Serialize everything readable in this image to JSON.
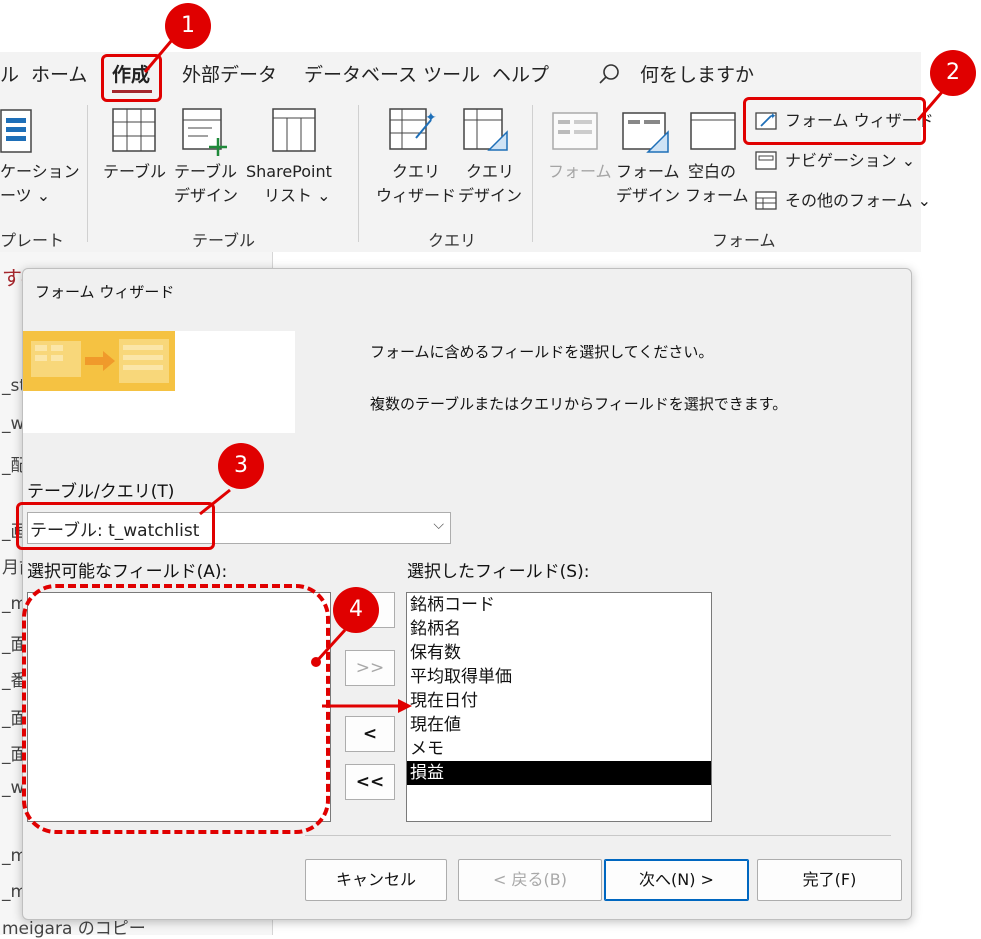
{
  "ribbon": {
    "tabs": [
      "ル",
      "ホーム",
      "作成",
      "外部データ",
      "データベース ツール",
      "ヘルプ"
    ],
    "active_tab_index": 2,
    "search_placeholder": "何をしますか",
    "groups": {
      "templates": {
        "label": "プレート",
        "item_line1": "ケーション",
        "item_line2": "ーツ ⌄"
      },
      "tables": {
        "label": "テーブル",
        "table": "テーブル",
        "table_design_1": "テーブル",
        "table_design_2": "デザイン",
        "sharepoint_1": "SharePoint",
        "sharepoint_2": "リスト ⌄"
      },
      "queries": {
        "label": "クエリ",
        "wizard_1": "クエリ",
        "wizard_2": "ウィザード",
        "design_1": "クエリ",
        "design_2": "デザイン"
      },
      "forms": {
        "label": "フォーム",
        "form": "フォーム",
        "form_design_1": "フォーム",
        "form_design_2": "デザイン",
        "blank_1": "空白の",
        "blank_2": "フォーム",
        "wizard": "フォーム ウィザード",
        "navigation": "ナビゲーション ⌄",
        "more": "その他のフォーム ⌄"
      }
    }
  },
  "nav_pane": {
    "items": [
      "すべての A",
      "_st",
      "_w",
      "_配",
      "_画",
      "月前",
      "_m",
      "_面",
      "_番",
      "_面",
      "_面",
      "_w",
      "_m",
      "_m",
      "meigara のコピー"
    ]
  },
  "dialog": {
    "title": "フォーム ウィザード",
    "instruction_1": "フォームに含めるフィールドを選択してください。",
    "instruction_2": "複数のテーブルまたはクエリからフィールドを選択できます。",
    "table_query_label": "テーブル/クエリ(T)",
    "table_query_value": "テーブル: t_watchlist",
    "available_label": "選択可能なフィールド(A):",
    "selected_label": "選択したフィールド(S):",
    "available_fields": [],
    "selected_fields": [
      "銘柄コード",
      "銘柄名",
      "保有数",
      "平均取得単価",
      "現在日付",
      "現在値",
      "メモ",
      "損益"
    ],
    "selected_index": 7,
    "move_buttons": {
      "add_one": ">",
      "add_all": ">>",
      "remove_one": "<",
      "remove_all": "<<"
    },
    "buttons": {
      "cancel": "キャンセル",
      "back": "< 戻る(B)",
      "next": "次へ(N) >",
      "finish": "完了(F)"
    }
  },
  "callouts": [
    "1",
    "2",
    "3",
    "4"
  ],
  "colors": {
    "accent_red": "#e00000",
    "ribbon_bg": "#f3f3f3",
    "dialog_bg": "#f0f0f0",
    "active_tab_underline": "#a4262c"
  }
}
